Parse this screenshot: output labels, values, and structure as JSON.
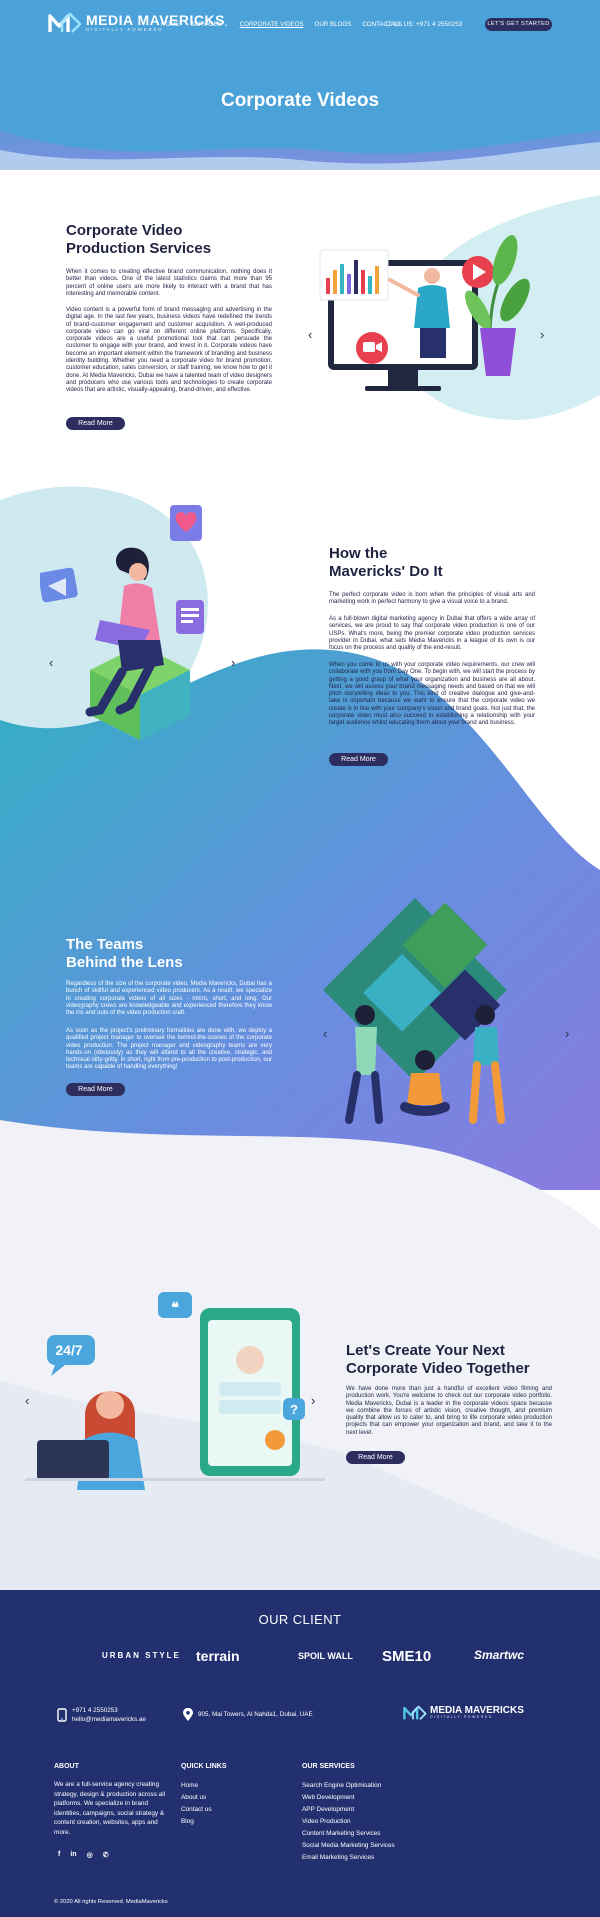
{
  "header": {
    "logo_name": "MEDIA MAVERICKS",
    "logo_tagline": "DIGITALLY POWERED",
    "nav": [
      {
        "label": "HOME"
      },
      {
        "label": "SERVICES"
      },
      {
        "label": "CORPORATE VIDEOS"
      },
      {
        "label": "OUR BLOGS"
      },
      {
        "label": "CONTACT US"
      }
    ],
    "call": "CALL US: +971 4 2550253",
    "cta": "LET'S GET STARTED"
  },
  "hero": {
    "title": "Corporate Videos"
  },
  "section1": {
    "title_line1": "Corporate Video",
    "title_line2": "Production Services",
    "p1": "When it comes to creating effective brand communication, nothing does it better than videos. One of the latest statistics claims that more than 95 percent of online users are more likely to interact with a brand that has interesting and memorable content.",
    "p2": "Video content is a powerful form of brand messaging and advertising in the digital age. In the last few years, business videos have redefined the trends of brand-customer engagement and customer acquisition. A well-produced corporate video can go viral on different online platforms. Specifically, corporate videos are a useful promotional tool that can persuade the customer to engage with your brand, and invest in it. Corporate videos have become an important element within the framework of branding and business identity building. Whether you need a corporate video for brand promotion, customer education, sales conversion, or staff training, we know how to get it done. At Media Mavericks, Dubai we have a talented team of video designers and producers who use various tools and technologies to create corporate videos that are artistic, visually-appealing, brand-driven, and effective.",
    "button": "Read More"
  },
  "section2": {
    "title_line1": "How the",
    "title_line2": "Mavericks' Do It",
    "p1": "The perfect corporate video is born when the principles of visual arts and marketing work in perfect harmony to give a visual voice to a brand.",
    "p2": "As a full-blown digital marketing agency in Dubai that offers a wide array of services, we are proud to say that corporate video production is one of our USPs. What's more, being the premier corporate video production services provider in Dubai, what sets Media Mavericks in a league of its own is our focus on the process and quality of the end-result.",
    "p3": "When you come to us with your corporate video requirements, our crew will collaborate with you from Day One. To begin with, we will start the process by getting a good grasp of what your organization and business are all about. Next, we will assess your brand messaging needs and based on that we will pitch storytelling ideas to you. This kind of creative dialogue and give-and-take is important because we want to ensure that the corporate video we create is in line with your company's vision and brand goals. Not just that, the corporate video must also succeed in establishing a relationship with your target audience whilst educating them about your brand and business.",
    "button": "Read More"
  },
  "section3": {
    "title_line1": "The Teams",
    "title_line2": "Behind the Lens",
    "p1": "Regardless of the size of the corporate video, Media Mavericks, Dubai has a bunch of skillful and experienced video producers. As a result, we specialize in creating corporate videos of all sizes - micro, short, and long. Our videography crews are knowledgeable and experienced therefore they know the ins and outs of the video production craft.",
    "p2": "As soon as the project's preliminary formalities are done with, we deploy a qualified project manager to oversee the behind-the-scenes of the corporate video production. The project manager and videography teams are very hands-on (obviously) as they will attend to all the creative, strategic, and technical nitty-gritty. In short, right from pre-production to post-production, our teams are capable of handling everything!",
    "button": "Read More"
  },
  "section4": {
    "title_line1": "Let's Create Your Next",
    "title_line2": "Corporate Video Together",
    "p1": "We have done more than just a handful of excellent video filming and production work. You're welcome to check out our corporate video portfolio. Media Mavericks, Dubai is a leader in the corporate videos space because we combine the forces of artistic vision, creative thought, and premium quality that allow us to cater to, and bring to life corporate video production projects that can empower your organization and brand, and take it to the next level.",
    "button": "Read More",
    "badge": "24/7"
  },
  "clients": {
    "title": "OUR CLIENT",
    "logos": [
      "URBAN STYLE",
      "terrain",
      "SPOIL WALL",
      "SME10",
      "Smartwc"
    ]
  },
  "contact": {
    "phone": "+971 4 2550253",
    "email": "hello@mediamavericks.ae",
    "address": "905, Mai Towers, Al Nahda1, Dubai, UAE"
  },
  "footer": {
    "about_heading": "ABOUT",
    "about_text": "We are a full-service agency creating strategy, design & production across all platforms. We specialize in brand identities, campaigns, social strategy & content creation, websites, apps and more.",
    "quick_heading": "QUICK LINKS",
    "quick_links": [
      "Home",
      "About us",
      "Contact us",
      "Blog"
    ],
    "services_heading": "OUR SERVICES",
    "services": [
      "Search Engine Optimisation",
      "Web Development",
      "APP Development",
      "Video Production",
      "Content Marketing Services",
      "Social Media Marketing Services",
      "Email Marketing Services"
    ],
    "social": [
      "f",
      "in",
      "ig",
      "wa"
    ],
    "copyright": "© 2020 All rights Reserved. MediaMavericks"
  },
  "colors": {
    "accent": "#2d2d60",
    "teal": "#36b7c6",
    "footer": "#23306f"
  }
}
